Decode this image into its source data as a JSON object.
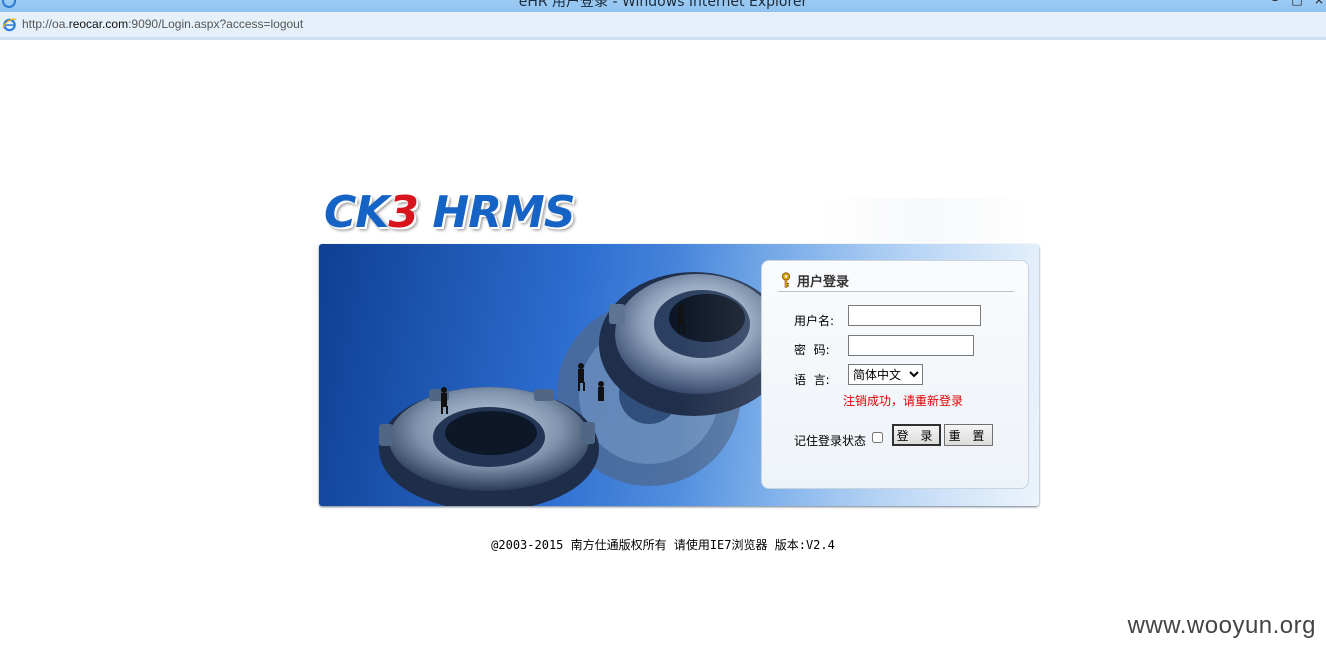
{
  "window": {
    "title": "eHR 用户登录 - Windows Internet Explorer",
    "url_prefix": "http://oa.",
    "url_host": "reocar.com",
    "url_suffix": ":9090/Login.aspx?access=logout"
  },
  "logo": {
    "part1": "CK",
    "part2": "3",
    "part3": " HRMS"
  },
  "login": {
    "title": "用户登录",
    "username_label": "用户名:",
    "username_value": "",
    "password_label": "密  码:",
    "password_value": "",
    "language_label": "语  言:",
    "language_selected": "简体中文",
    "message": "注销成功，请重新登录",
    "remember_label": "记住登录状态",
    "login_button": "登 录",
    "reset_button": "重 置"
  },
  "footer": "@2003-2015 南方仕通版权所有 请使用IE7浏览器 版本:V2.4",
  "watermark": "www.wooyun.org",
  "colors": {
    "accent": "#1563c4",
    "logo_red": "#d8141c",
    "error": "#e00000"
  }
}
